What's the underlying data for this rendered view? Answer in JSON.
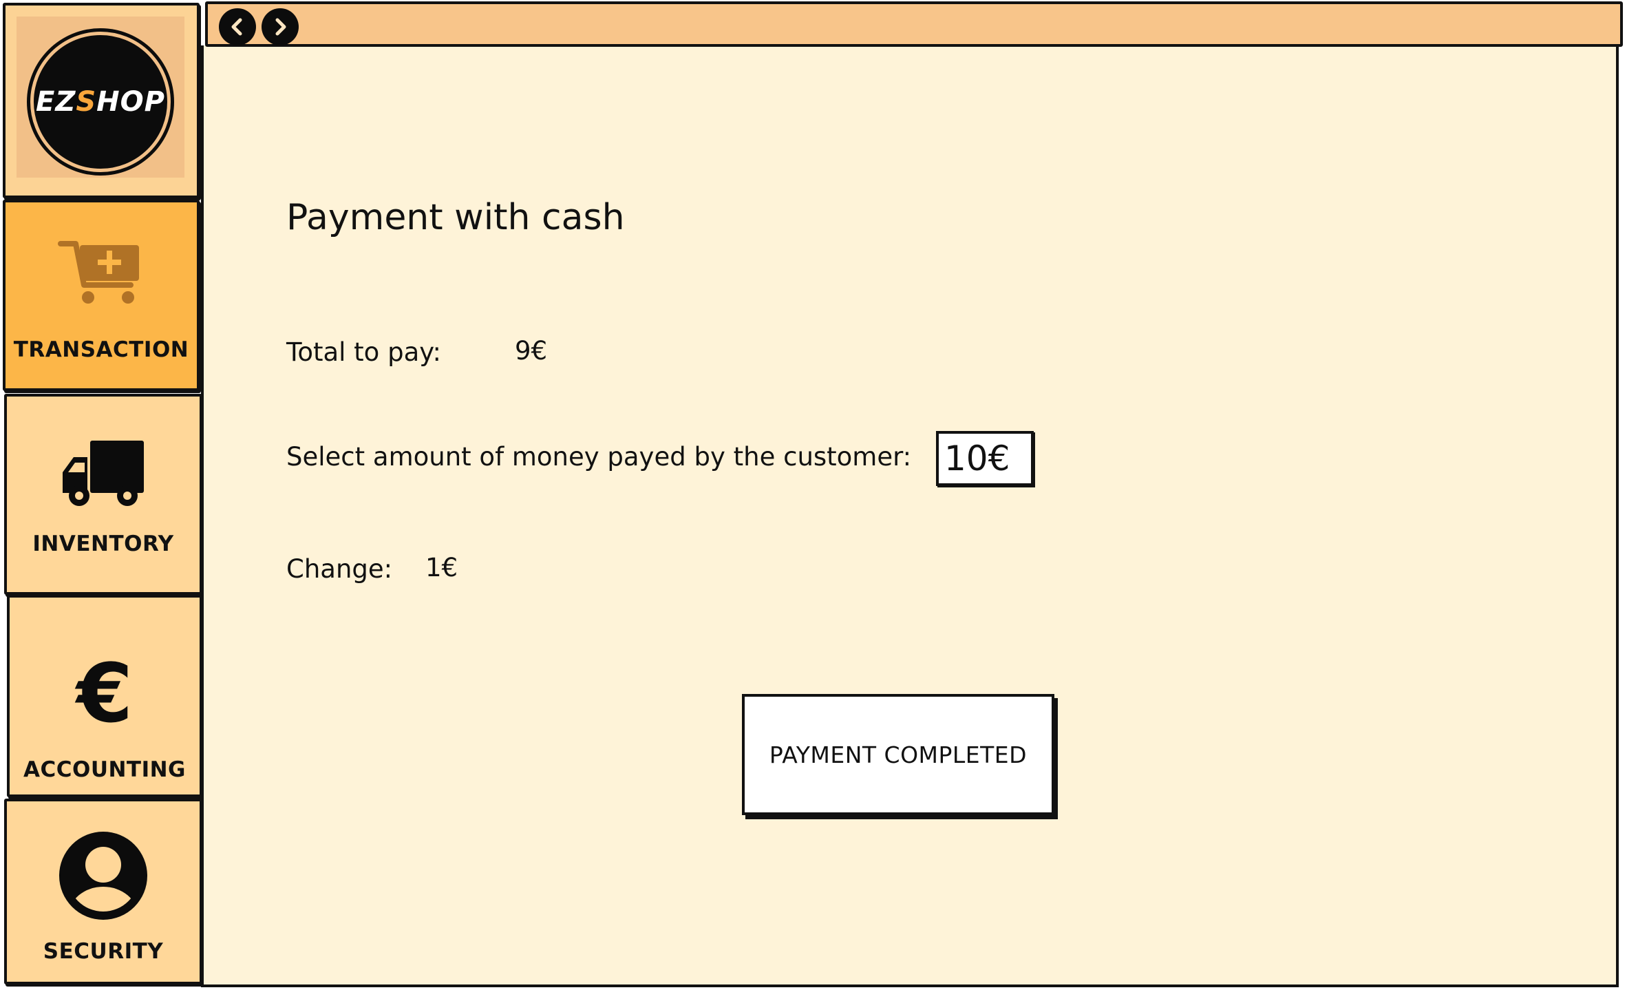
{
  "app": {
    "logo_text_part1": "EZ",
    "logo_text_accent": "S",
    "logo_text_part2": "HOP"
  },
  "colors": {
    "page_background": "#fef3d8",
    "titlebar": "#f8c58a",
    "sidebar_item": "#ffd799",
    "sidebar_item_active": "#fcb648",
    "icon_brown": "#b07226",
    "logo_accent": "#f9a63b"
  },
  "sidebar": {
    "items": [
      {
        "id": "transaction",
        "label": "TRANSACTION",
        "icon": "cart-plus-icon",
        "active": true
      },
      {
        "id": "inventory",
        "label": "INVENTORY",
        "icon": "truck-icon",
        "active": false
      },
      {
        "id": "accounting",
        "label": "ACCOUNTING",
        "icon": "euro-icon",
        "active": false
      },
      {
        "id": "security",
        "label": "SECURITY",
        "icon": "user-icon",
        "active": false
      }
    ]
  },
  "browser": {
    "back_icon": "chevron-left-icon",
    "forward_icon": "chevron-right-icon"
  },
  "payment": {
    "title": "Payment with cash",
    "total_label": "Total to pay:",
    "total_value": "9€",
    "paid_label": "Select amount of money payed by the customer:",
    "paid_value": "10€",
    "change_label": "Change:",
    "change_value": "1€",
    "button_label": "PAYMENT COMPLETED"
  }
}
